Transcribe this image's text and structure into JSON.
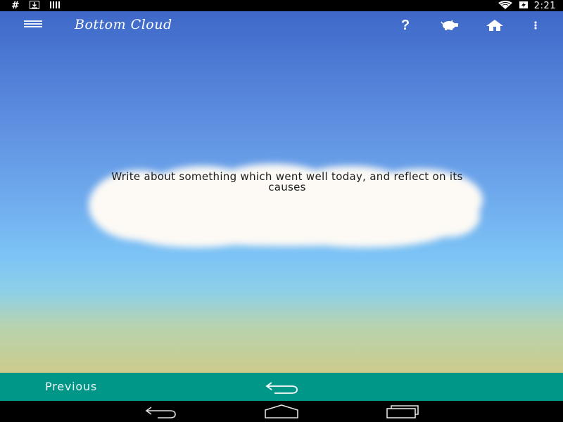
{
  "status_bar": {
    "left_icons": [
      "hash-icon",
      "download-icon",
      "signal-bars-icon"
    ],
    "hash_glyph": "#",
    "right_icons": [
      "wifi-icon",
      "battery-icon"
    ],
    "time": "2:21"
  },
  "action_bar": {
    "title": "Bottom Cloud",
    "icons": [
      "menu-icon",
      "help-icon",
      "piggy-bank-icon",
      "home-icon",
      "overflow-menu-icon"
    ],
    "help_glyph": "?"
  },
  "prompt": {
    "text": "Write about something which went well today, and reflect on its causes"
  },
  "bottom_bar": {
    "previous_label": "Previous",
    "undo_icon": "undo-arrow-icon"
  },
  "nav_bar": {
    "icons": [
      "back-icon",
      "home-icon",
      "recents-icon"
    ]
  },
  "colors": {
    "sky_top": "#3f68c8",
    "sky_bottom": "#cccb8c",
    "bottom_bar": "#009688",
    "cloud": "#fdfaf5"
  }
}
